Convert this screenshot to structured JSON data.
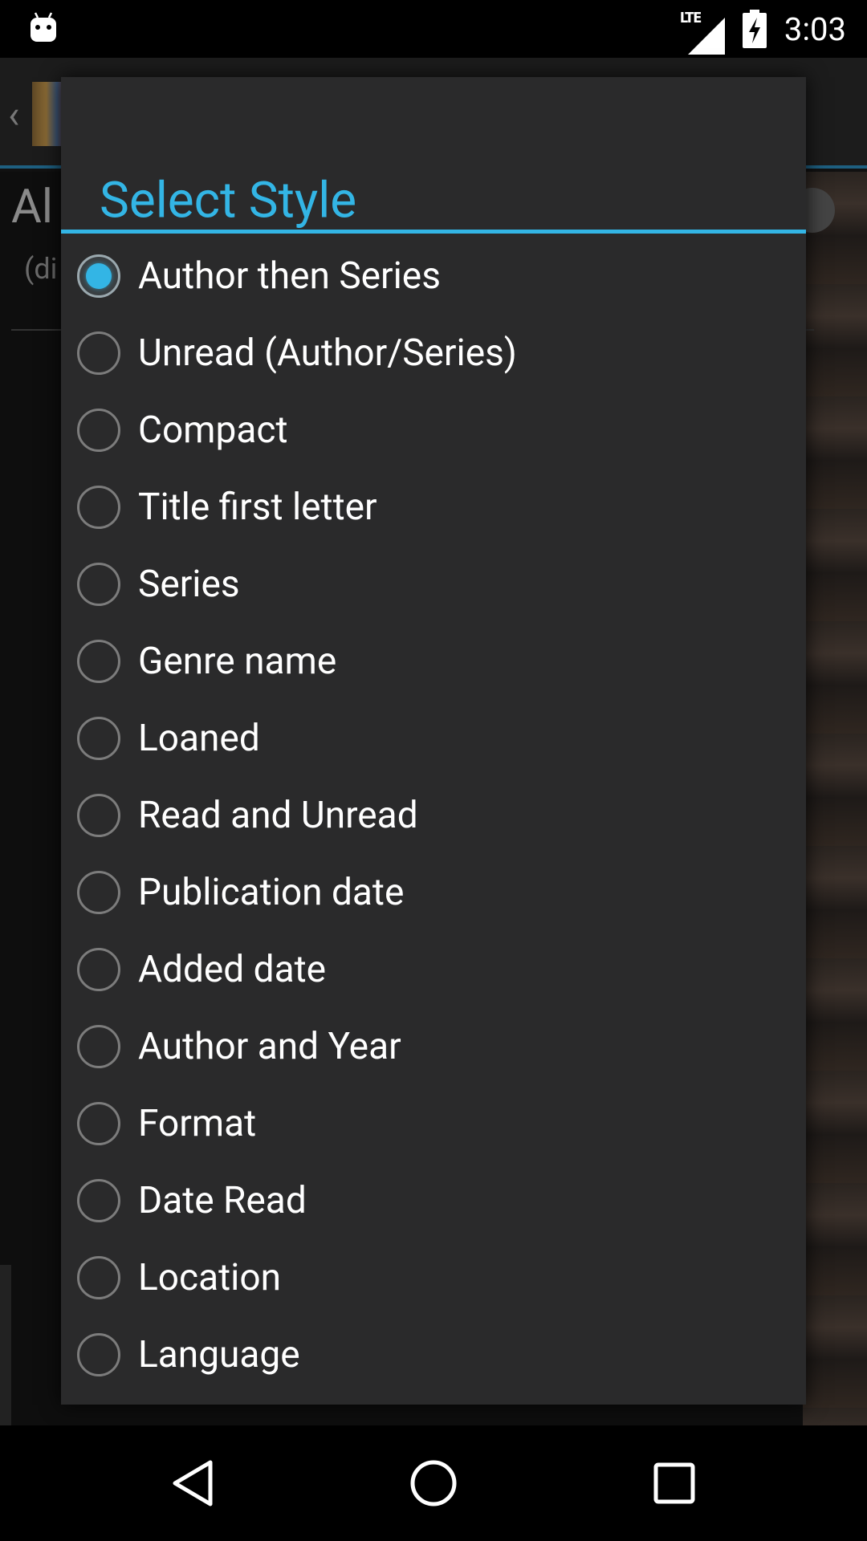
{
  "status_bar": {
    "network": "LTE",
    "time": "3:03",
    "icons": [
      "android-notification-icon",
      "signal-icon",
      "battery-charging-icon"
    ]
  },
  "background_app": {
    "heading": "Al",
    "subtitle": "(di"
  },
  "dialog": {
    "title": "Select Style",
    "accent_color": "#33b5e5",
    "selected_index": 0,
    "options": [
      {
        "label": "Author then Series",
        "checked": true
      },
      {
        "label": "Unread (Author/Series)",
        "checked": false
      },
      {
        "label": "Compact",
        "checked": false
      },
      {
        "label": "Title first letter",
        "checked": false
      },
      {
        "label": "Series",
        "checked": false
      },
      {
        "label": "Genre name",
        "checked": false
      },
      {
        "label": "Loaned",
        "checked": false
      },
      {
        "label": "Read and Unread",
        "checked": false
      },
      {
        "label": "Publication date",
        "checked": false
      },
      {
        "label": "Added date",
        "checked": false
      },
      {
        "label": "Author and Year",
        "checked": false
      },
      {
        "label": "Format",
        "checked": false
      },
      {
        "label": "Date Read",
        "checked": false
      },
      {
        "label": "Location",
        "checked": false
      },
      {
        "label": "Language",
        "checked": false
      }
    ]
  },
  "nav_bar": {
    "buttons": [
      "back-icon",
      "home-icon",
      "recents-icon"
    ]
  }
}
